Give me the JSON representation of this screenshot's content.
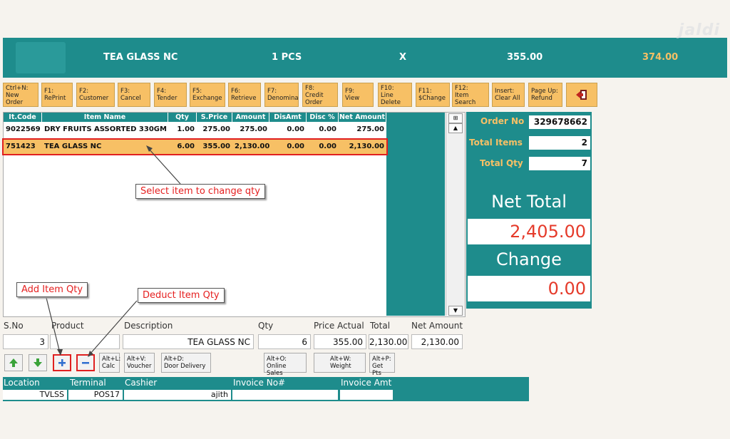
{
  "banner": {
    "item": "TEA GLASS NC",
    "qty": "1 PCS",
    "x": "X",
    "price": "355.00",
    "total": "374.00"
  },
  "logo": "jaldi",
  "fkeys": [
    {
      "l1": "Ctrl+N:",
      "l2": "New",
      "l3": "Order"
    },
    {
      "l1": "F1:",
      "l2": "RePrint",
      "l3": ""
    },
    {
      "l1": "F2:",
      "l2": "Customer",
      "l3": ""
    },
    {
      "l1": "F3:",
      "l2": "Cancel",
      "l3": ""
    },
    {
      "l1": "F4:",
      "l2": "Tender",
      "l3": ""
    },
    {
      "l1": "F5:",
      "l2": "Exchange",
      "l3": ""
    },
    {
      "l1": "F6:",
      "l2": "Retrieve",
      "l3": ""
    },
    {
      "l1": "F7:",
      "l2": "Denomina",
      "l3": ""
    },
    {
      "l1": "F8:",
      "l2": "Credit",
      "l3": "Order"
    },
    {
      "l1": "F9:",
      "l2": "View",
      "l3": ""
    },
    {
      "l1": "F10:",
      "l2": "Line",
      "l3": "Delete"
    },
    {
      "l1": "F11:",
      "l2": "$Change",
      "l3": ""
    },
    {
      "l1": "F12:",
      "l2": "Item",
      "l3": "Search"
    },
    {
      "l1": "Insert:",
      "l2": "Clear All",
      "l3": ""
    },
    {
      "l1": "Page Up:",
      "l2": "Refund",
      "l3": ""
    }
  ],
  "grid": {
    "headers": [
      "It.Code",
      "Item Name",
      "Qty",
      "S.Price",
      "Amount",
      "DisAmt",
      "Disc %",
      "Net Amount"
    ],
    "rows": [
      [
        "9022569",
        "DRY FRUITS ASSORTED 330GM",
        "1.00",
        "275.00",
        "275.00",
        "0.00",
        "0.00",
        "275.00"
      ],
      [
        "751423",
        "TEA GLASS NC",
        "6.00",
        "355.00",
        "2,130.00",
        "0.00",
        "0.00",
        "2,130.00"
      ]
    ]
  },
  "summary": {
    "order_no_label": "Order No",
    "order_no": "329678662",
    "total_items_label": "Total Items",
    "total_items": "2",
    "total_qty_label": "Total Qty",
    "total_qty": "7",
    "net_total_label": "Net Total",
    "net_total": "2,405.00",
    "change_label": "Change",
    "change": "0.00"
  },
  "form": {
    "labels": [
      "S.No",
      "Product",
      "Description",
      "Qty",
      "Price Actual",
      "Total",
      "Net Amount"
    ],
    "sno": "3",
    "product": "",
    "description": "TEA GLASS NC",
    "qty": "6",
    "price_actual": "355.00",
    "total": "2,130.00",
    "net_amount": "2,130.00"
  },
  "buttons": [
    {
      "l1": "Alt+L:",
      "l2": "Calc"
    },
    {
      "l1": "Alt+V:",
      "l2": "Voucher"
    },
    {
      "l1": "Alt+D:",
      "l2": "Door Delivery"
    },
    {
      "l1": "Alt+O:",
      "l2": "Online Sales"
    },
    {
      "l1": "Alt+W:",
      "l2": "Weight"
    },
    {
      "l1": "Alt+P:",
      "l2": "Get Pts"
    }
  ],
  "status": {
    "labels": [
      "Location",
      "Terminal",
      "Cashier",
      "Invoice No#",
      "Invoice Amt"
    ],
    "location": "TVLSS",
    "terminal": "POS17",
    "cashier": "ajith",
    "invoice_no": "",
    "invoice_amt": ""
  },
  "callouts": {
    "select": "Select item to change qty",
    "add": "Add Item Qty",
    "deduct": "Deduct Item Qty"
  },
  "colors": {
    "teal": "#1e8c8c",
    "orange": "#f7c065",
    "red": "#e53a2a"
  }
}
